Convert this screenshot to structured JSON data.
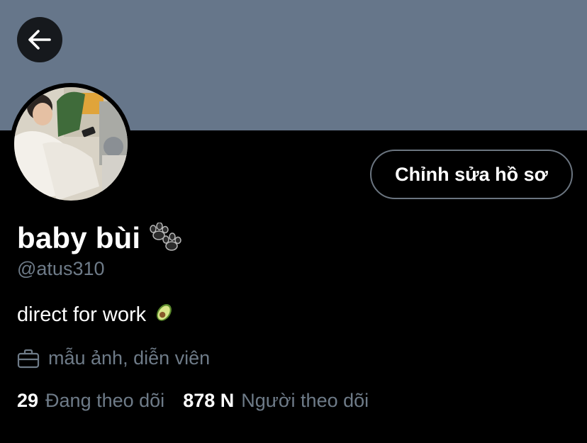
{
  "profile": {
    "display_name": "baby bùi",
    "name_emoji": "paw-prints-icon",
    "handle": "@atus310",
    "bio": "direct for work",
    "bio_emoji": "avocado-icon",
    "job": "mẫu ảnh, diễn viên",
    "job_icon": "briefcase-icon"
  },
  "actions": {
    "back_icon": "arrow-left-icon",
    "edit_profile_label": "Chỉnh sửa hồ sơ"
  },
  "stats": {
    "following_count": "29",
    "following_label": "Đang theo dõi",
    "followers_count": "878 N",
    "followers_label": "Người theo dõi"
  },
  "colors": {
    "banner": "#66768a",
    "background": "#000000",
    "secondary_text": "#6e7b88",
    "button_border": "#6b7580"
  }
}
